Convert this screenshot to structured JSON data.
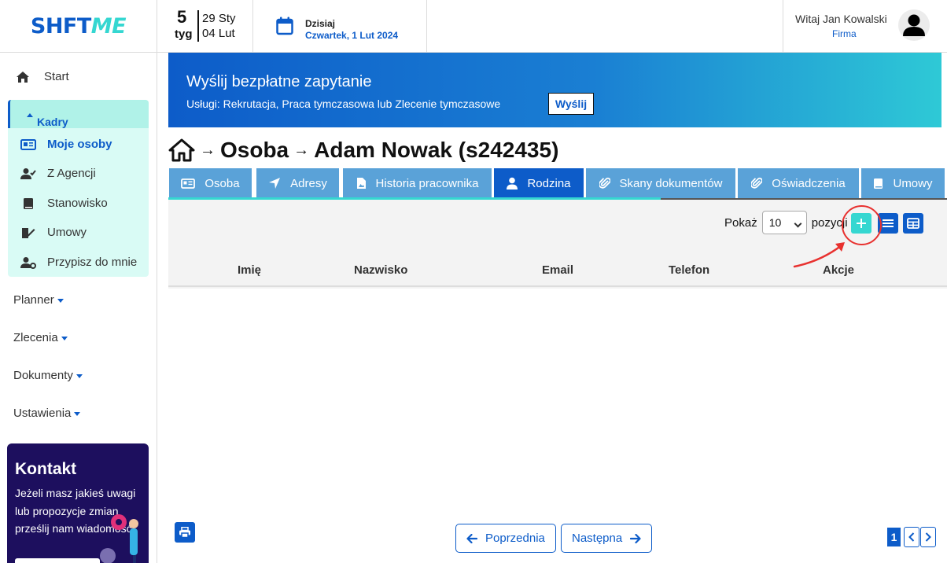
{
  "header": {
    "logo_main": "SHFT",
    "logo_accent": "ME",
    "week_number": "5",
    "week_label": "tyg",
    "week_start": "29 Sty",
    "week_end": "04 Lut",
    "today_label": "Dzisiaj",
    "today_date": "Czwartek, 1 Lut 2024",
    "greeting": "Witaj Jan Kowalski",
    "role": "Firma"
  },
  "sidebar": {
    "start": "Start",
    "kadry": "Kadry",
    "kadry_items": [
      "Moje osoby",
      "Z Agencji",
      "Stanowisko",
      "Umowy",
      "Przypisz do mnie"
    ],
    "groups": [
      "Planner",
      "Zlecenia",
      "Dokumenty",
      "Ustawienia"
    ],
    "contact_title": "Kontakt",
    "contact_text": "Jeżeli masz jakieś uwagi lub propozycje zmian prześlij nam wiadomość"
  },
  "banner": {
    "title": "Wyślij bezpłatne zapytanie",
    "subtitle": "Usługi: Rekrutacja, Praca tymczasowa lub Zlecenie tymczasowe",
    "button": "Wyślij"
  },
  "breadcrumb": {
    "level1": "Osoba",
    "level2": "Adam Nowak (s242435)"
  },
  "tabs": [
    "Osoba",
    "Adresy",
    "Historia pracownika",
    "Rodzina",
    "Skany dokumentów",
    "Oświadczenia",
    "Umowy"
  ],
  "active_tab": "Rodzina",
  "table": {
    "show_label": "Pokaż",
    "page_size": "10",
    "show_suffix": "pozycji",
    "columns": [
      "Imię",
      "Nazwisko",
      "Email",
      "Telefon",
      "Akcje"
    ],
    "rows": []
  },
  "pagination": {
    "prev": "Poprzednia",
    "next": "Następna",
    "current_page": "1"
  },
  "colors": {
    "primary": "#0d5cc9",
    "accent": "#35d7d1",
    "annotation": "#e8312f"
  }
}
